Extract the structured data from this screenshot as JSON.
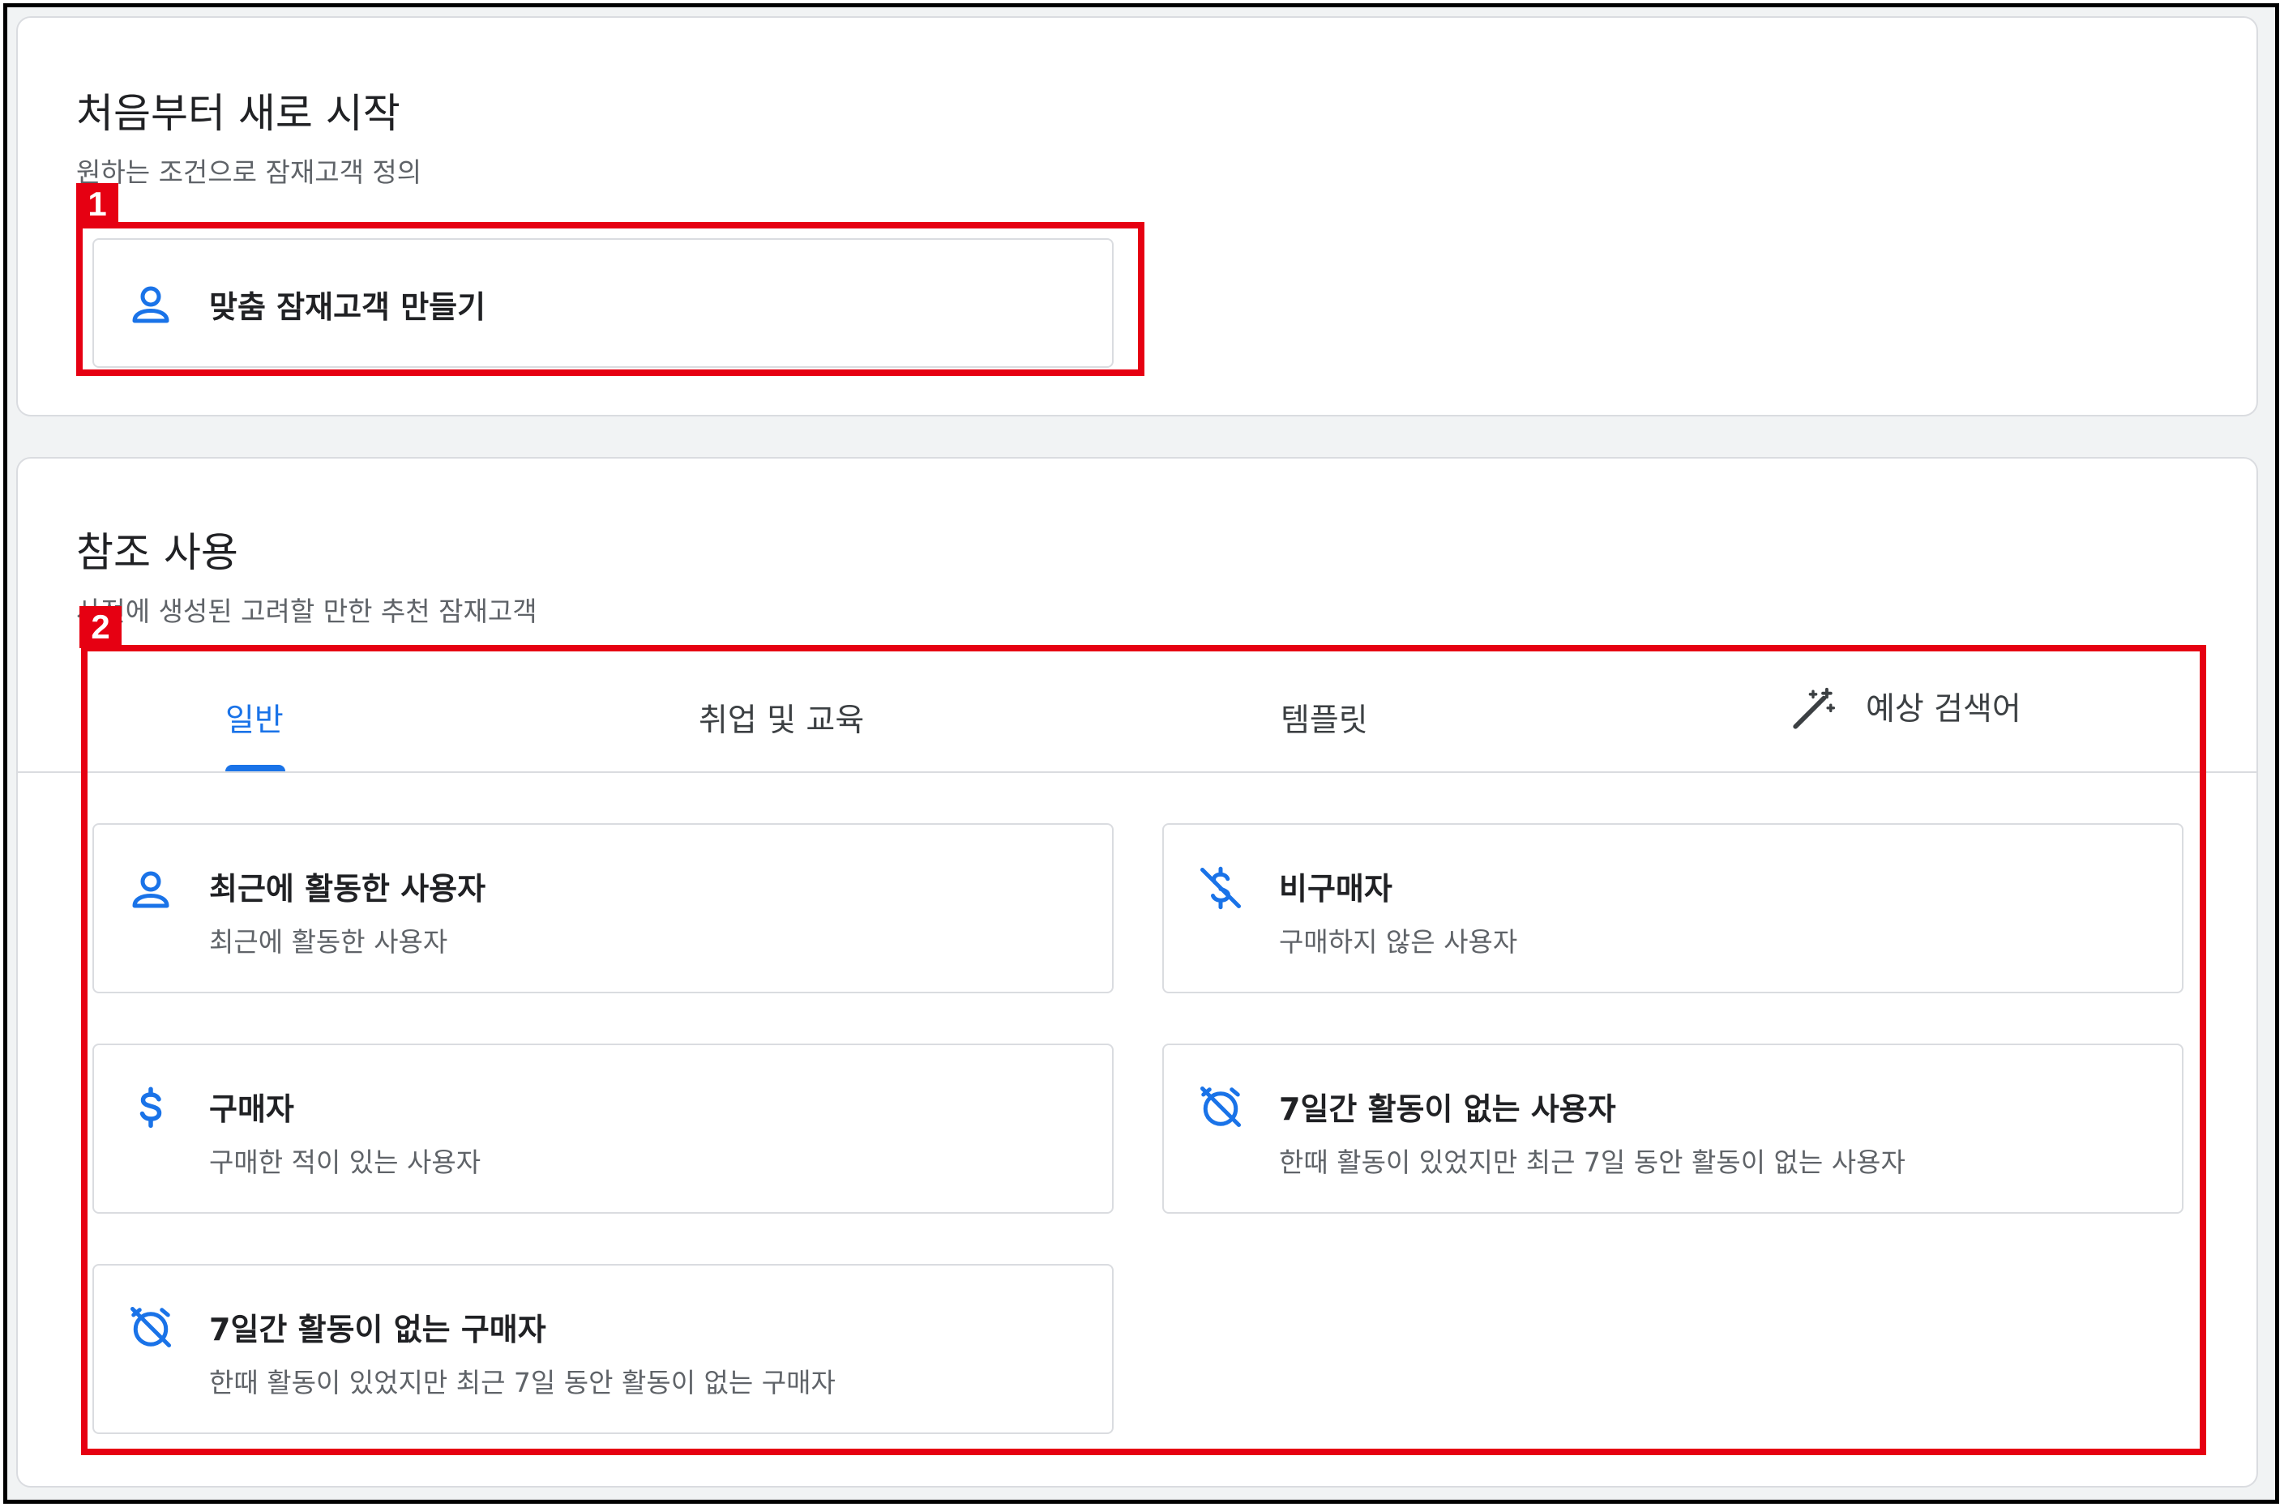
{
  "fresh_start": {
    "title": "처음부터 새로 시작",
    "subtitle": "원하는 조건으로 잠재고객 정의",
    "custom_option": {
      "label": "맞춤 잠재고객 만들기",
      "icon": "person-icon"
    }
  },
  "reference": {
    "title": "참조 사용",
    "subtitle": "사전에 생성된 고려할 만한 추천 잠재고객",
    "tabs": [
      {
        "label": "일반",
        "active": true
      },
      {
        "label": "취업 및 교육",
        "active": false
      },
      {
        "label": "템플릿",
        "active": false
      },
      {
        "label": "예상 검색어",
        "active": false,
        "icon": "magic-wand-icon"
      }
    ],
    "options": [
      {
        "title": "최근에 활동한 사용자",
        "description": "최근에 활동한 사용자",
        "icon": "person-icon"
      },
      {
        "title": "비구매자",
        "description": "구매하지 않은 사용자",
        "icon": "money-off-icon"
      },
      {
        "title": "구매자",
        "description": "구매한 적이 있는 사용자",
        "icon": "dollar-icon"
      },
      {
        "title": "7일간 활동이 없는 사용자",
        "description": "한때 활동이 있었지만 최근 7일 동안 활동이 없는 사용자",
        "icon": "alarm-off-icon"
      },
      {
        "title": "7일간 활동이 없는 구매자",
        "description": "한때 활동이 있었지만 최근 7일 동안 활동이 없는 구매자",
        "icon": "alarm-off-icon"
      }
    ]
  },
  "annotations": [
    {
      "label": "1"
    },
    {
      "label": "2"
    }
  ],
  "colors": {
    "accent": "#1a73e8",
    "highlight": "#e60012",
    "border": "#dadce0"
  }
}
